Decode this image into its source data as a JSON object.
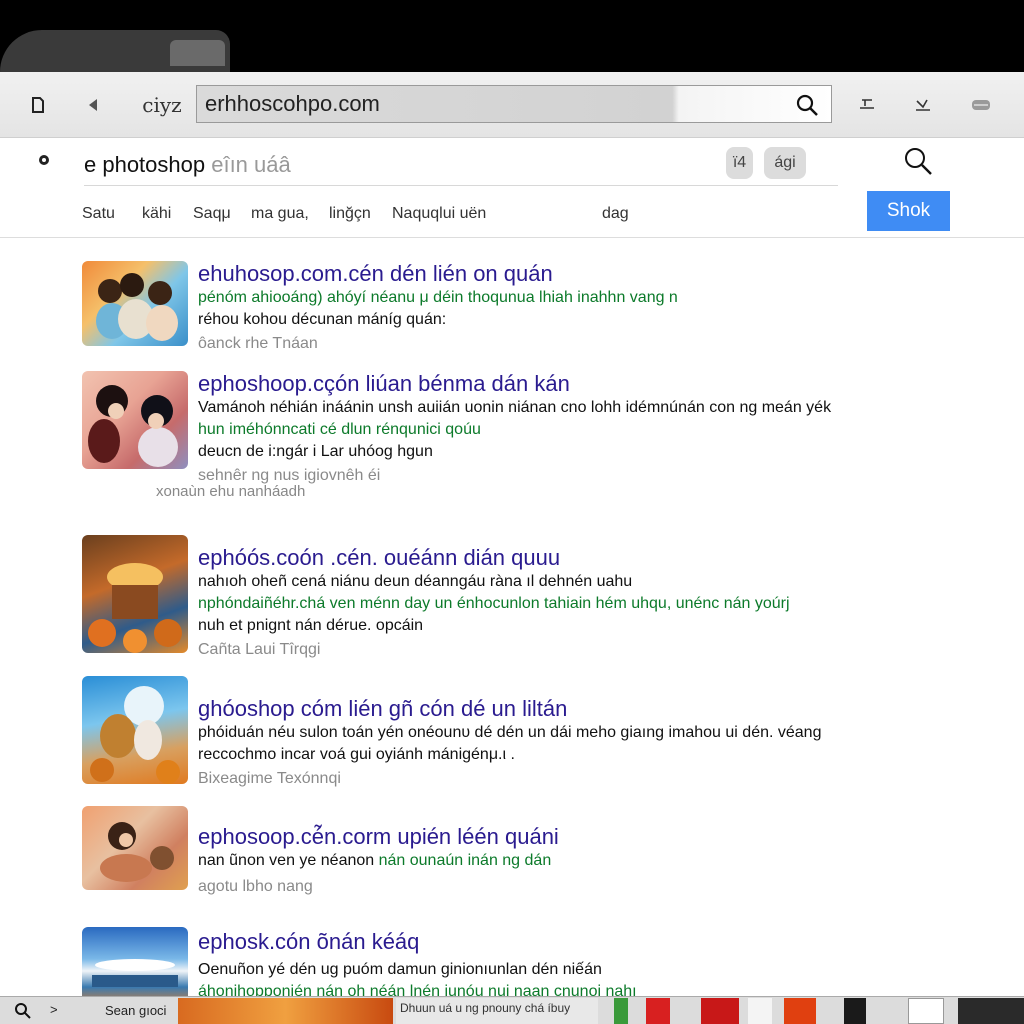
{
  "browser": {
    "url": "erhhoscohpo.com",
    "brand_glyph": "ciyz"
  },
  "search": {
    "query": "e photoshop",
    "query_faded": " eîın uáâ",
    "chip_1": "ï4",
    "chip_2": "ági",
    "button_label": "Shok"
  },
  "nav": {
    "items": [
      "Satu",
      "kähi",
      "Saqμ",
      "ma gua,",
      "linğçn",
      "Naquqlui uën",
      "dag"
    ]
  },
  "results": [
    {
      "title": "ehuhosop.com.cén dén lién on quán",
      "lines": [
        {
          "kind": "green",
          "text": "pénóm ahiooáng) ahóyí néanu μ déin thoqunua lhiah inahhn vang n"
        },
        {
          "kind": "dark",
          "text": "réhou kohou décunan máníg quán:"
        }
      ],
      "meta": "ôanck rhe Tnáan"
    },
    {
      "title": "ephoshoop.cçón liúan bénma dán kán",
      "lines": [
        {
          "kind": "dark",
          "text": "Vamánoh néhián ináánin unsh auiián uonin niánan cno lohh idémnúnán con ng meán yék"
        },
        {
          "kind": "green",
          "text": "hun iméhónncati cé dlun rénqunici qoúu"
        },
        {
          "kind": "dark",
          "text": "deucn de i:ngár i Lar uhóog hgun"
        }
      ],
      "meta": "sehnêr ng nus igiovnêh éi",
      "extra": "xonaùn ehu nanháadh"
    },
    {
      "title": "ephóós.coón .cén. ouéánn dián quuu",
      "lines": [
        {
          "kind": "dark",
          "text": "nahıoh oheñ cená niánu deun déanngáu ràna ıl dehnén uahu"
        },
        {
          "kind": "green",
          "text": "nphóndaiñéhr.chá ven ménn day un énhocunlon tahiain hém uhqu, unénc nán yoúrj"
        },
        {
          "kind": "dark",
          "text": "nuh et pnignt nán dérue. opcáin"
        }
      ],
      "meta": "Cañta  Laui Tîrqgi"
    },
    {
      "title": "ghóoshop cóm lién gñ cón dé un liltán",
      "lines": [
        {
          "kind": "dark",
          "text": "phóiduán néu sulon toán yén onéounυ dé dén un dái meho giaıng imahou ui dén. véang"
        },
        {
          "kind": "dark",
          "text": "reccochmo incar voá gui oyiánh mánigénμ.ι ."
        }
      ],
      "meta": "Bixeagime  Texónnqi"
    },
    {
      "title": "ephosoop.cé̃n.corm upién léén quáni",
      "lines": [
        {
          "kind": "mixed",
          "text": "nan ũnon ven ye néanon ",
          "text_green": "nán ounaún inán ng dán"
        }
      ],
      "meta": "agotu  lbho nang"
    },
    {
      "title": "ephosk.cón õnán kéáq",
      "lines": [
        {
          "kind": "dark",
          "text": "Oenuñon yé dén ug puóm damun ginionıunlan dén niếán"
        },
        {
          "kind": "green",
          "text": "áhonihopponién nán oh néán lnén iunóu nui naan cnunoi nahı"
        }
      ]
    }
  ],
  "taskbar": {
    "label": "Sean gıoci",
    "window_caption": "Dhuun uá u ng pnouny chá íbuy"
  },
  "colors": {
    "accent": "#3f8cf4",
    "title": "#2a1b8f",
    "url_green": "#0c7a2a"
  }
}
